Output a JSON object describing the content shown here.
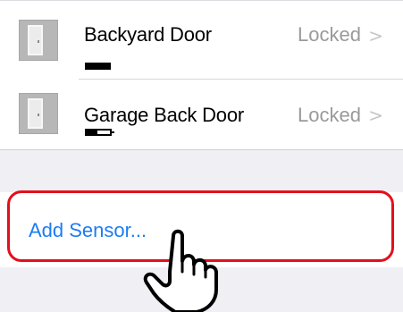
{
  "sensors": [
    {
      "name": "Backyard Door",
      "status": "Locked",
      "chevron": ">",
      "battery": 1.0
    },
    {
      "name": "Garage Back Door",
      "status": "Locked",
      "chevron": ">",
      "battery": 0.4
    }
  ],
  "add_sensor": {
    "label": "Add Sensor..."
  },
  "colors": {
    "accent": "#1c7cf4",
    "highlight": "#e40f1c",
    "status": "#9a9a9a",
    "background": "#efeff4"
  },
  "icons": {
    "sensor": "door-icon",
    "pointer": "hand-pointer-icon"
  }
}
